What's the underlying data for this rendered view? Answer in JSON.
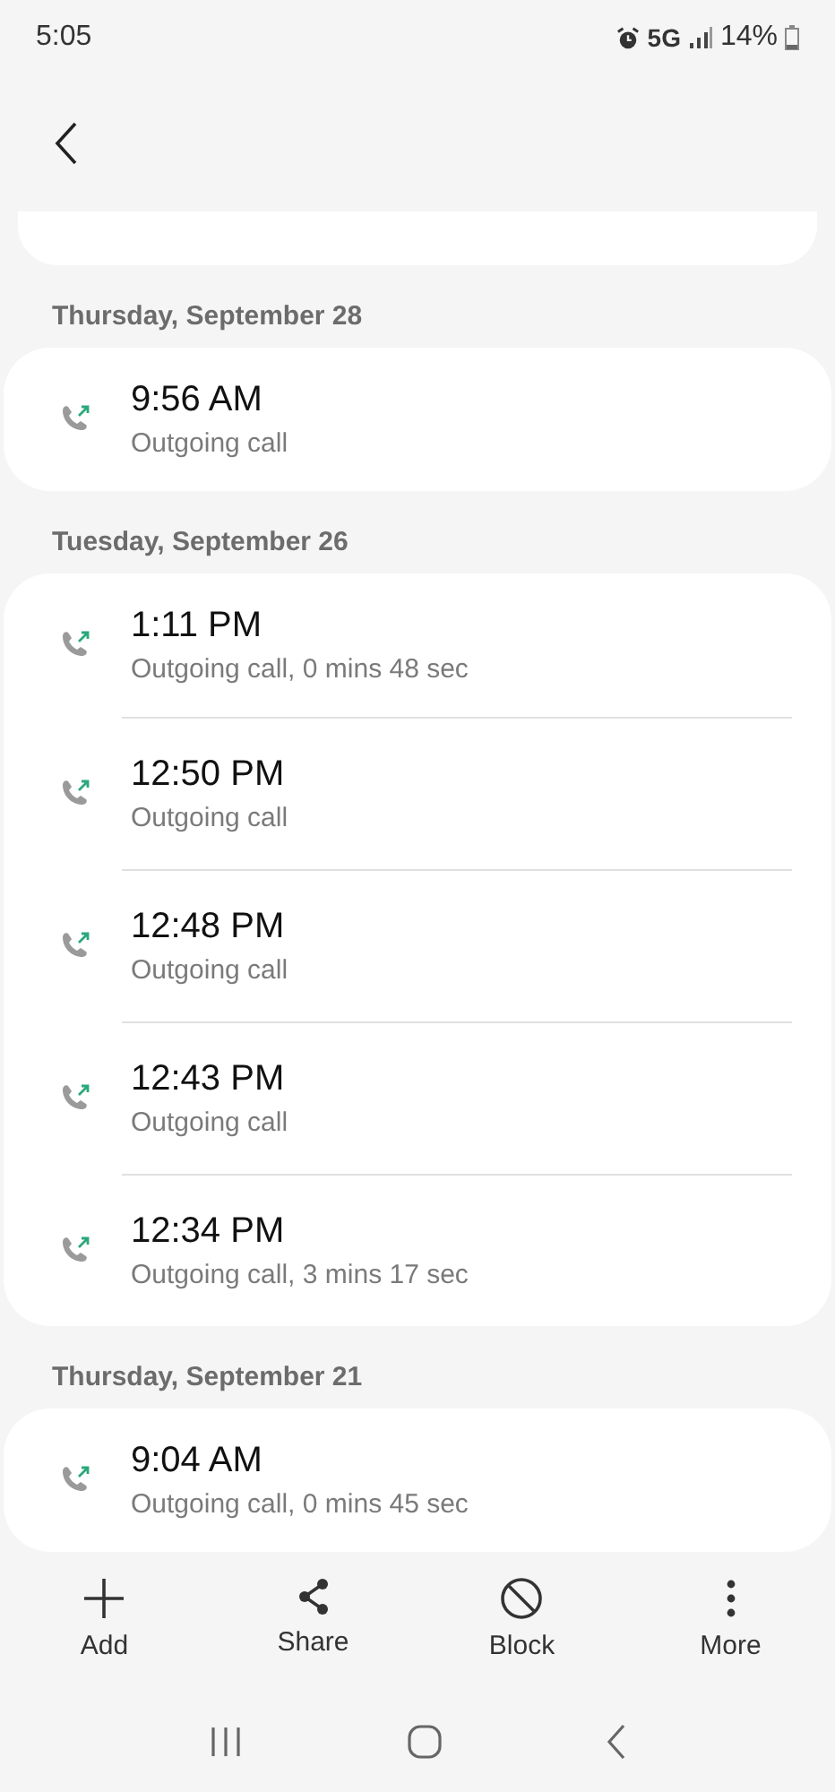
{
  "status_bar": {
    "time": "5:05",
    "network": "5G",
    "battery": "14%"
  },
  "groups": [
    {
      "date": "Thursday, September 28",
      "calls": [
        {
          "time": "9:56 AM",
          "detail": "Outgoing call"
        }
      ]
    },
    {
      "date": "Tuesday, September 26",
      "calls": [
        {
          "time": "1:11 PM",
          "detail": "Outgoing call, 0 mins 48 sec"
        },
        {
          "time": "12:50 PM",
          "detail": "Outgoing call"
        },
        {
          "time": "12:48 PM",
          "detail": "Outgoing call"
        },
        {
          "time": "12:43 PM",
          "detail": "Outgoing call"
        },
        {
          "time": "12:34 PM",
          "detail": "Outgoing call, 3 mins 17 sec"
        }
      ]
    },
    {
      "date": "Thursday, September 21",
      "calls": [
        {
          "time": "9:04 AM",
          "detail": "Outgoing call, 0 mins 45 sec"
        }
      ]
    }
  ],
  "actions": [
    {
      "kind": "add",
      "label": "Add"
    },
    {
      "kind": "share",
      "label": "Share"
    },
    {
      "kind": "block",
      "label": "Block"
    },
    {
      "kind": "more",
      "label": "More"
    }
  ]
}
